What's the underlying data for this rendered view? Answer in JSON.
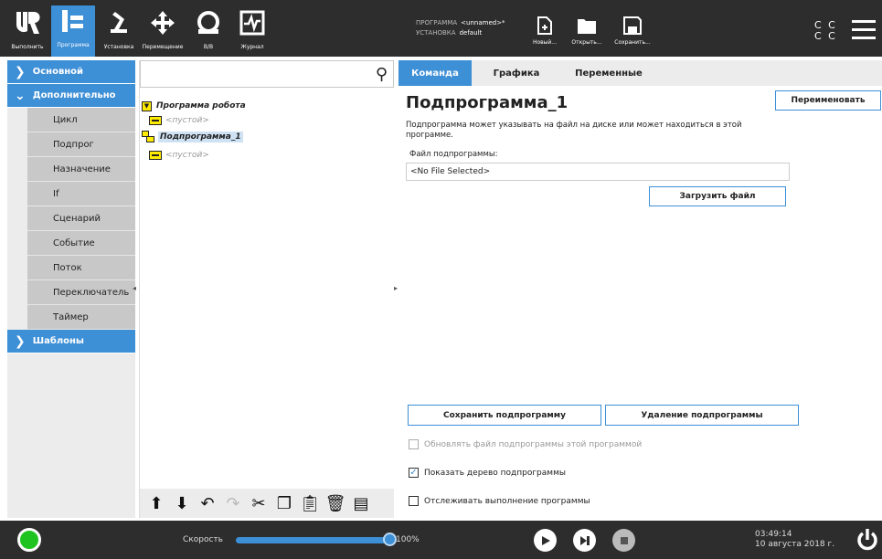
{
  "topbar": {
    "nav": [
      {
        "label": "Выполнить",
        "icon": "ur-logo-icon"
      },
      {
        "label": "Программа",
        "icon": "program-icon"
      },
      {
        "label": "Установка",
        "icon": "robot-arm-icon"
      },
      {
        "label": "Перемещение",
        "icon": "move-arrows-icon"
      },
      {
        "label": "В/В",
        "icon": "io-icon"
      },
      {
        "label": "Журнал",
        "icon": "log-icon"
      }
    ],
    "program_label": "ПРОГРАММА",
    "program_value": "<unnamed>*",
    "install_label": "УСТАНОВКА",
    "install_value": "default",
    "new_label": "Новый...",
    "open_label": "Открыть...",
    "save_label": "Сохранить...",
    "cc_line1": "C C",
    "cc_line2": "C C"
  },
  "leftnav": {
    "basic": "Основной",
    "advanced": "Дополнительно",
    "items": [
      "Цикл",
      "Подпрог",
      "Назначение",
      "If",
      "Сценарий",
      "Событие",
      "Поток",
      "Переключатель",
      "Таймер"
    ],
    "templates": "Шаблоны"
  },
  "tree": {
    "search_placeholder": "",
    "robot_program": "Программа робота",
    "empty1": "<пустой>",
    "subprogram": "Подпрограмма_1",
    "empty2": "<пустой>"
  },
  "tabs": [
    "Команда",
    "Графика",
    "Переменные"
  ],
  "content": {
    "title": "Подпрограмма_1",
    "rename_button": "Переименовать",
    "description": "Подпрограмма может указывать на файл на диске или может находиться в этой программе.",
    "file_label": "Файл подпрограммы:",
    "file_value": "<No File Selected>",
    "load_button": "Загрузить файл",
    "save_sub_button": "Сохранить подпрограмму",
    "delete_sub_button": "Удаление подпрограммы",
    "update_checkbox": "Обновлять файл подпрограммы этой программой",
    "show_tree_checkbox": "Показать дерево подпрограммы",
    "track_checkbox": "Отслеживать выполнение программы"
  },
  "bottombar": {
    "speed_label": "Скорость",
    "speed_value": "100%",
    "speed_fraction": 1.0,
    "time": "03:49:14",
    "date": "10 августа 2018 г.",
    "status_color": "#1fc31f"
  },
  "colors": {
    "accent": "#3d8fd6",
    "topbar": "#2d2d2d",
    "tree_node": "#ffeb00"
  }
}
